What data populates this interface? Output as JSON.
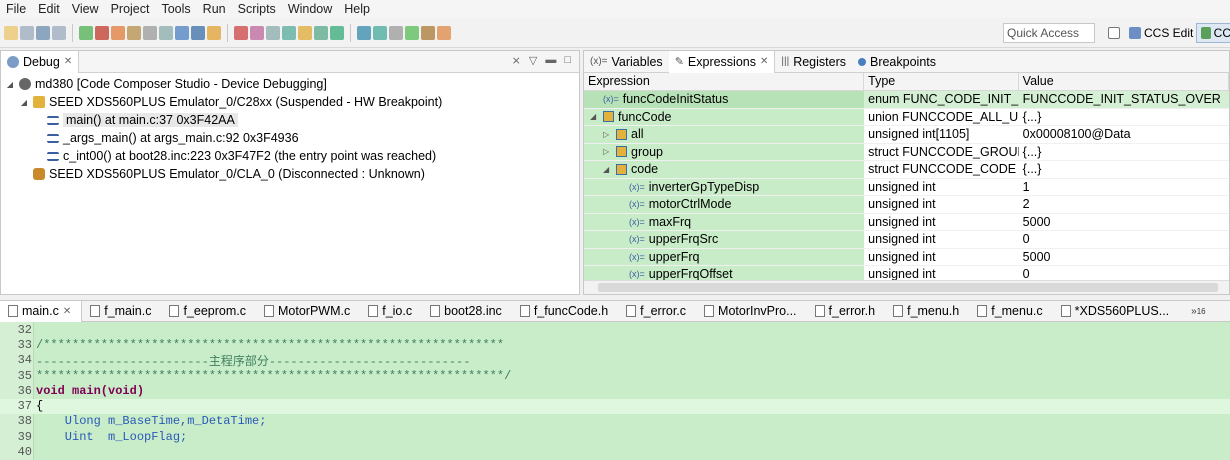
{
  "menu": [
    "File",
    "Edit",
    "View",
    "Project",
    "Tools",
    "Run",
    "Scripts",
    "Window",
    "Help"
  ],
  "toolbar": {
    "quick_access_placeholder": "Quick Access",
    "perspective_edit": "CCS Edit",
    "perspective_debug": "CC"
  },
  "debug_view": {
    "tab_label": "Debug",
    "tree": [
      {
        "label": "md380 [Code Composer Studio - Device Debugging]",
        "level": 0,
        "icon": "debug-session-icon"
      },
      {
        "label": "SEED XDS560PLUS Emulator_0/C28xx (Suspended - HW Breakpoint)",
        "level": 1,
        "icon": "target-icon"
      },
      {
        "label": "main() at main.c:37 0x3F42AA",
        "level": 2,
        "icon": "stack-frame-icon",
        "selected": true
      },
      {
        "label": "_args_main() at args_main.c:92 0x3F4936",
        "level": 2,
        "icon": "stack-frame-icon"
      },
      {
        "label": "c_int00() at boot28.inc:223 0x3F47F2  (the entry point was reached)",
        "level": 2,
        "icon": "stack-frame-icon"
      },
      {
        "label": "SEED XDS560PLUS Emulator_0/CLA_0 (Disconnected : Unknown)",
        "level": 1,
        "icon": "disconnected-target-icon"
      }
    ]
  },
  "expressions_view": {
    "tabs": [
      "Variables",
      "Expressions",
      "Registers",
      "Breakpoints"
    ],
    "active_tab": "Expressions",
    "columns": [
      "Expression",
      "Type",
      "Value"
    ],
    "rows": [
      {
        "name": "funcCodeInitStatus",
        "type": "enum FUNC_CODE_INIT_...",
        "value": "FUNCCODE_INIT_STATUS_OVER",
        "level": 0,
        "icon": "variable-icon",
        "toggle": ""
      },
      {
        "name": "funcCode",
        "type": "union FUNCCODE_ALL_U...",
        "value": "{...}",
        "level": 0,
        "icon": "struct-icon",
        "toggle": "expanded"
      },
      {
        "name": "all",
        "type": "unsigned int[1105]",
        "value": "0x00008100@Data",
        "level": 1,
        "icon": "struct-icon",
        "toggle": "collapsed"
      },
      {
        "name": "group",
        "type": "struct FUNCCODE_GROUP",
        "value": "{...}",
        "level": 1,
        "icon": "struct-icon",
        "toggle": "collapsed"
      },
      {
        "name": "code",
        "type": "struct FUNCCODE_CODE",
        "value": "{...}",
        "level": 1,
        "icon": "struct-icon",
        "toggle": "expanded"
      },
      {
        "name": "inverterGpTypeDisp",
        "type": "unsigned int",
        "value": "1",
        "level": 2,
        "icon": "variable-icon",
        "toggle": ""
      },
      {
        "name": "motorCtrlMode",
        "type": "unsigned int",
        "value": "2",
        "level": 2,
        "icon": "variable-icon",
        "toggle": ""
      },
      {
        "name": "maxFrq",
        "type": "unsigned int",
        "value": "5000",
        "level": 2,
        "icon": "variable-icon",
        "toggle": ""
      },
      {
        "name": "upperFrqSrc",
        "type": "unsigned int",
        "value": "0",
        "level": 2,
        "icon": "variable-icon",
        "toggle": ""
      },
      {
        "name": "upperFrq",
        "type": "unsigned int",
        "value": "5000",
        "level": 2,
        "icon": "variable-icon",
        "toggle": ""
      },
      {
        "name": "upperFrqOffset",
        "type": "unsigned int",
        "value": "0",
        "level": 2,
        "icon": "variable-icon",
        "toggle": ""
      }
    ]
  },
  "editor": {
    "tabs": [
      "main.c",
      "f_main.c",
      "f_eeprom.c",
      "MotorPWM.c",
      "f_io.c",
      "boot28.inc",
      "f_funcCode.h",
      "f_error.c",
      "MotorInvPro...",
      "f_error.h",
      "f_menu.h",
      "f_menu.c",
      "*XDS560PLUS..."
    ],
    "active_tab": "main.c",
    "overflow_count": "16",
    "lines": [
      {
        "num": "32",
        "text": ""
      },
      {
        "num": "33",
        "text": "/****************************************************************"
      },
      {
        "num": "34",
        "text": "------------------------主程序部分----------------------------"
      },
      {
        "num": "35",
        "text": "*****************************************************************/"
      },
      {
        "num": "36",
        "text": "void main(void)"
      },
      {
        "num": "37",
        "text": "{"
      },
      {
        "num": "38",
        "text": "    Ulong m_BaseTime,m_DetaTime;"
      },
      {
        "num": "39",
        "text": "    Uint  m_LoopFlag;"
      },
      {
        "num": "40",
        "text": ""
      }
    ]
  },
  "colors": {
    "highlight_green": "#c9ecc9",
    "comment": "#3f7f5f",
    "keyword": "#7f0055"
  }
}
